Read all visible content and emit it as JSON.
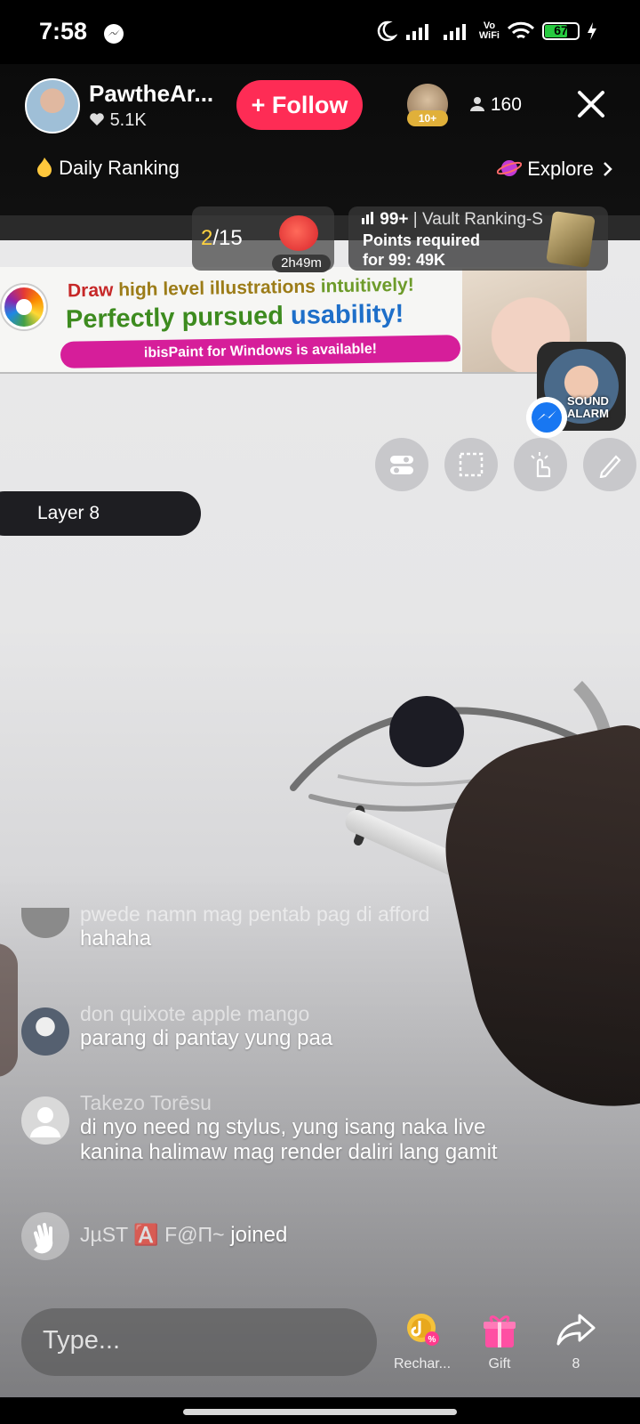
{
  "status_bar": {
    "time": "7:58",
    "battery_level": "67",
    "vowifi_top": "Vo",
    "vowifi_bottom": "WiFi"
  },
  "header": {
    "host_name": "PawtheAr...",
    "likes": "5.1K",
    "follow_label": "+ Follow",
    "gifter_badge": "10+",
    "viewer_count": "160",
    "daily_ranking": "Daily Ranking",
    "explore": "Explore"
  },
  "ranking": {
    "rank_current": "2",
    "rank_total": "/15",
    "timer": "2h49m",
    "vault_rank": "99+",
    "vault_title": "Vault Ranking-S",
    "points_line1": "Points required",
    "points_line2": "for 99: 49K"
  },
  "stream_content": {
    "banner_line1_a": "Draw ",
    "banner_line1_b": "high level illustrations ",
    "banner_line1_c": "intuitively!",
    "banner_line2_a": "Perfectly pursued ",
    "banner_line2_b": "usability!",
    "banner_pill": "ibisPaint for Windows is available!",
    "layer_label": "Layer 8"
  },
  "pip": {
    "line1": "SOUND",
    "line2": "ALARM"
  },
  "comments": [
    {
      "name": "pwede namn mag pentab pag di afford",
      "text": "hahaha"
    },
    {
      "name": "don quixote apple mango",
      "text": "parang di pantay yung paa"
    },
    {
      "name": "Takezo Torēsu",
      "text": "di nyo need ng stylus, yung isang naka live",
      "text2": "kanina halimaw mag render daliri lang gamit"
    }
  ],
  "join_event": {
    "user": "JµST 🅰️ F@Π~",
    "action": " joined"
  },
  "bottom_bar": {
    "input_placeholder": "Type...",
    "recharge_label": "Rechar...",
    "gift_label": "Gift",
    "share_count": "8"
  },
  "colors": {
    "follow": "#fe2c55",
    "accent_yellow": "#ffd23f",
    "battery_green": "#27c93f"
  }
}
